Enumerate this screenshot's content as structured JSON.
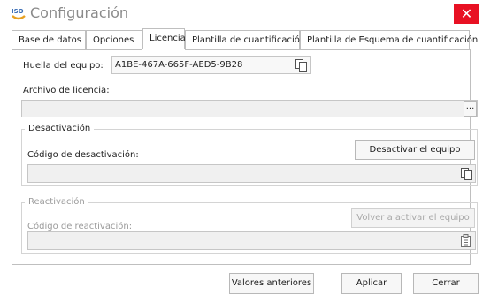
{
  "window": {
    "title": "Configuración",
    "logo_text": "ISO",
    "close_label": "✕"
  },
  "tabs": [
    {
      "label": "Base de datos"
    },
    {
      "label": "Opciones"
    },
    {
      "label": "Licencia"
    },
    {
      "label": "Plantilla de cuantificación"
    },
    {
      "label": "Plantilla de Esquema de cuantificación"
    }
  ],
  "license": {
    "fingerprint_label": "Huella del equipo:",
    "fingerprint_value": "A1BE-467A-665F-AED5-9B28",
    "license_file_label": "Archivo de licencia:",
    "license_file_value": "",
    "browse_label": "..."
  },
  "deactivation": {
    "legend": "Desactivación",
    "code_label": "Código de desactivación:",
    "button_label": "Desactivar el equipo",
    "code_value": ""
  },
  "reactivation": {
    "legend": "Reactivación",
    "code_label": "Código de reactivación:",
    "button_label": "Volver a activar el equipo",
    "code_value": ""
  },
  "footer": {
    "defaults_label": "Valores anteriores",
    "apply_label": "Aplicar",
    "close_label": "Cerrar"
  },
  "icons": {
    "copy": "copy-icon",
    "paste": "paste-icon",
    "close": "close-icon"
  },
  "colors": {
    "close_button": "#e81123",
    "title_text": "#8a8a8a",
    "logo_accent": "#e8a020"
  }
}
